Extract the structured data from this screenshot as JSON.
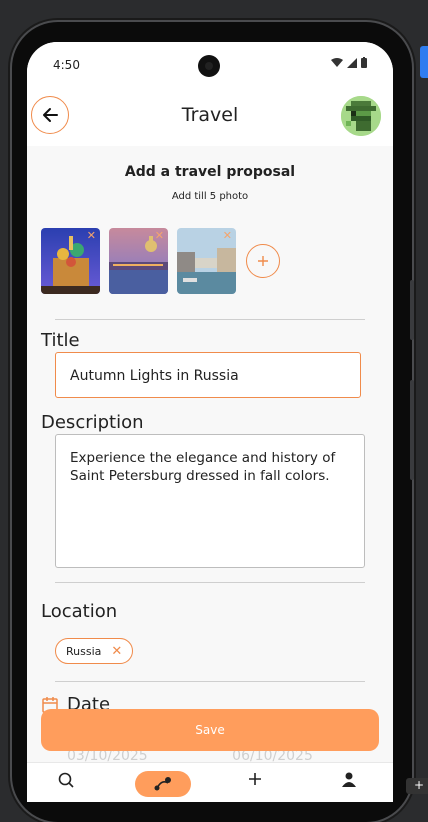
{
  "status": {
    "time": "4:50"
  },
  "appbar": {
    "title": "Travel"
  },
  "form": {
    "heading": "Add a travel proposal",
    "subheading": "Add till 5 photo",
    "title_label": "Title",
    "title_value": "Autumn Lights in Russia",
    "description_label": "Description",
    "description_value": "Experience the elegance and history of Saint Petersburg dressed in fall colors.",
    "location_label": "Location",
    "location_chip": "Russia",
    "date_label": "Date",
    "date_start": "03/10/2025",
    "date_end": "06/10/2025"
  },
  "actions": {
    "save_label": "Save"
  },
  "icons": {
    "back": "arrow-left-icon",
    "avatar": "pixel-avatar",
    "remove": "close-icon",
    "add": "plus-icon",
    "calendar": "calendar-icon",
    "nav": [
      "search-icon",
      "route-icon",
      "plus-icon",
      "person-icon"
    ]
  },
  "colors": {
    "accent": "#f08b4b",
    "button": "#ff9d5c",
    "background": "#f8f8f8"
  }
}
